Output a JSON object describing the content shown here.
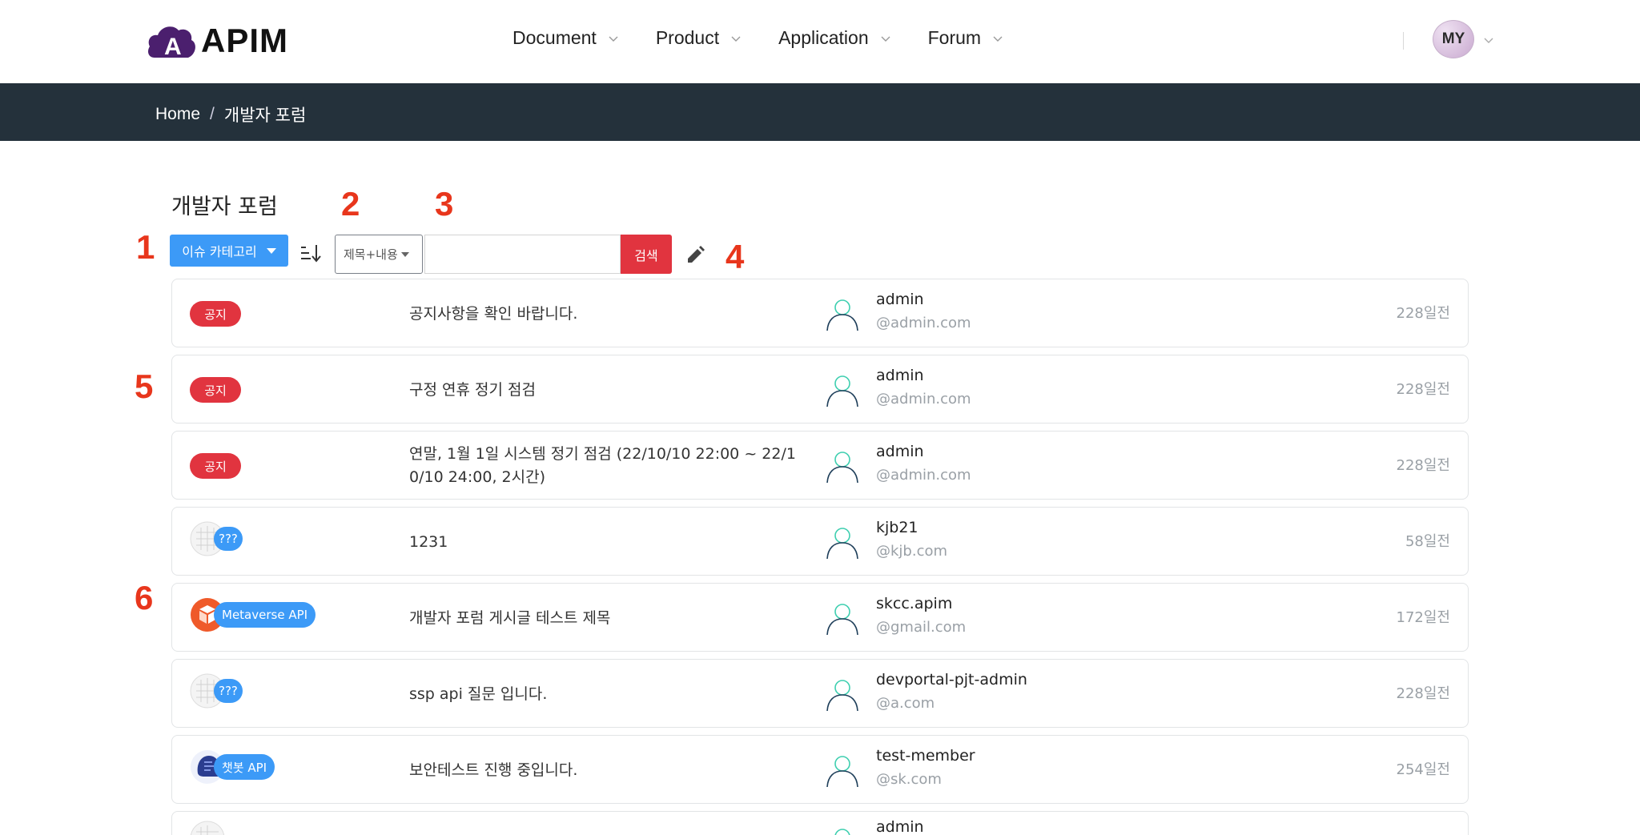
{
  "header": {
    "logo_text": "APIM",
    "nav": [
      {
        "label": "Document"
      },
      {
        "label": "Product"
      },
      {
        "label": "Application"
      },
      {
        "label": "Forum"
      }
    ],
    "avatar_text": "MY"
  },
  "breadcrumb": {
    "home": "Home",
    "separator": "/",
    "current": "개발자 포럼"
  },
  "page": {
    "title": "개발자 포럼"
  },
  "annotations": [
    "1",
    "2",
    "3",
    "4",
    "5",
    "6"
  ],
  "toolbar": {
    "category_label": "이슈 카테고리",
    "search_field_label": "제목+내용",
    "search_input_value": "",
    "search_button_label": "검색"
  },
  "colors": {
    "primary_blue": "#3c9af7",
    "danger_red": "#e1343f",
    "breadcrumb_bg": "#24313b",
    "annotation_red": "#e8361c",
    "user_icon_teal": "#3fcfb0"
  },
  "posts": [
    {
      "badge_type": "notice",
      "badge": "공지",
      "title": "공지사항을 확인 바랍니다.",
      "author": "admin",
      "email": "@admin.com",
      "date": "228일전"
    },
    {
      "badge_type": "notice",
      "badge": "공지",
      "title": "구정 연휴 정기 점검",
      "author": "admin",
      "email": "@admin.com",
      "date": "228일전"
    },
    {
      "badge_type": "notice",
      "badge": "공지",
      "title": "연말, 1월 1일 시스템 정기 점검 (22/10/10 22:00 ~ 22/10/10 24:00, 2시간)",
      "author": "admin",
      "email": "@admin.com",
      "date": "228일전"
    },
    {
      "badge_type": "category",
      "icon": "grid-placeholder-icon",
      "badge": "???",
      "title": "1231",
      "author": "kjb21",
      "email": "@kjb.com",
      "date": "58일전"
    },
    {
      "badge_type": "category",
      "icon": "metaverse-cube-icon",
      "badge": "Metaverse API",
      "title": "개발자 포럼 게시글 테스트 제목",
      "author": "skcc.apim",
      "email": "@gmail.com",
      "date": "172일전"
    },
    {
      "badge_type": "category",
      "icon": "grid-placeholder-icon",
      "badge": "???",
      "title": "ssp api 질문 입니다.",
      "author": "devportal-pjt-admin",
      "email": "@a.com",
      "date": "228일전"
    },
    {
      "badge_type": "category",
      "icon": "chatbot-head-icon",
      "badge": "챗봇 API",
      "title": "보안테스트 진행 중입니다.",
      "author": "test-member",
      "email": "@sk.com",
      "date": "254일전"
    },
    {
      "badge_type": "category",
      "icon": "grid-placeholder-icon",
      "badge": "",
      "title": "",
      "author": "admin",
      "email": "",
      "date": ""
    }
  ]
}
